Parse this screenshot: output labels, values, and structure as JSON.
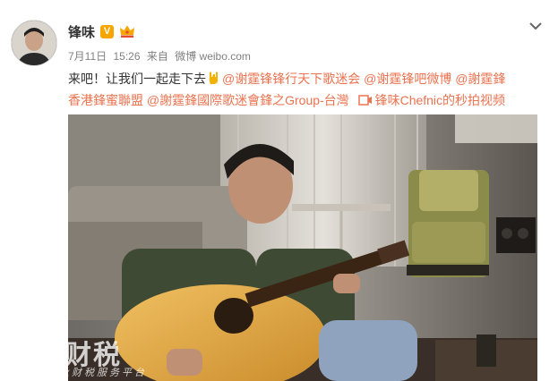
{
  "post": {
    "author": "锋味",
    "verified_badge": "V",
    "icons": {
      "avatar": "avatar-photo",
      "verified": "verified-v-icon",
      "member": "crown-icon",
      "menu": "chevron-down-icon"
    },
    "date": "7月11日",
    "time": "15:26",
    "source_prefix": "来自",
    "source": "微博 weibo.com",
    "text_line1_plain": "来吧！让我们一起走下去",
    "mentions": [
      "@谢霆锋锋行天下歌迷会",
      "@谢霆锋吧微博",
      "@謝霆鋒",
      "香港鋒蜜聯盟",
      "@謝霆鋒國際歌迷會鋒之Group-台灣"
    ],
    "video_link": "锋味Chefnic的秒拍视频"
  },
  "watermark": {
    "title": "深企财税",
    "subtitle": "一站式企业财税服务平台"
  },
  "colors": {
    "accent": "#eb7350",
    "meta": "#808080",
    "badge": "#f7a600"
  }
}
